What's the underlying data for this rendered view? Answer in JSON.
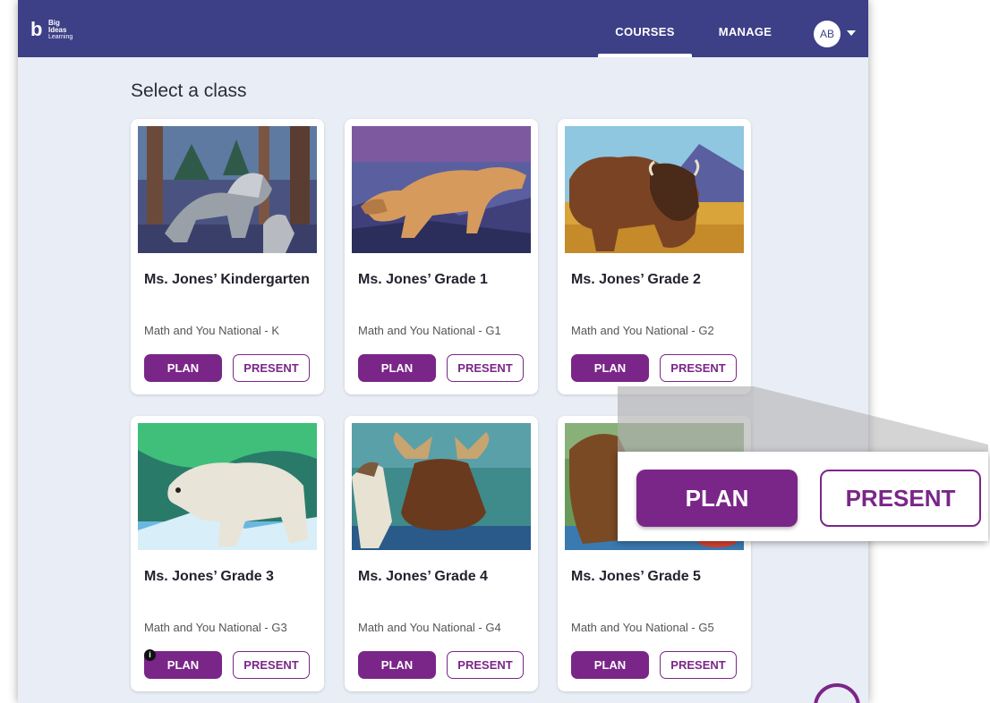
{
  "nav": {
    "logo_line1": "Big",
    "logo_line2": "Ideas",
    "logo_line3": "Learning",
    "courses": "COURSES",
    "manage": "MANAGE",
    "avatar_initials": "AB"
  },
  "page": {
    "title": "Select a class"
  },
  "cards": [
    {
      "title": "Ms. Jones’ Kindergarten",
      "course": "Math and You National - K",
      "plan": "PLAN",
      "present": "PRESENT",
      "image": "gray-wolves"
    },
    {
      "title": "Ms. Jones’ Grade 1",
      "course": "Math and You National - G1",
      "plan": "PLAN",
      "present": "PRESENT",
      "image": "cougar"
    },
    {
      "title": "Ms. Jones’ Grade 2",
      "course": "Math and You National - G2",
      "plan": "PLAN",
      "present": "PRESENT",
      "image": "bison"
    },
    {
      "title": "Ms. Jones’ Grade 3",
      "course": "Math and You National - G3",
      "plan": "PLAN",
      "present": "PRESENT",
      "image": "polar-bear"
    },
    {
      "title": "Ms. Jones’ Grade 4",
      "course": "Math and You National - G4",
      "plan": "PLAN",
      "present": "PRESENT",
      "image": "moose-and-osprey"
    },
    {
      "title": "Ms. Jones’ Grade 5",
      "course": "Math and You National - G5",
      "plan": "PLAN",
      "present": "PRESENT",
      "image": "grizzly-bear"
    }
  ],
  "zoom_callout": {
    "plan": "PLAN",
    "present": "PRESENT"
  },
  "icons": {
    "info": "i",
    "help": "help-icon"
  },
  "colors": {
    "header": "#3d3f87",
    "accent": "#7a2688",
    "background": "#e9edf5"
  }
}
